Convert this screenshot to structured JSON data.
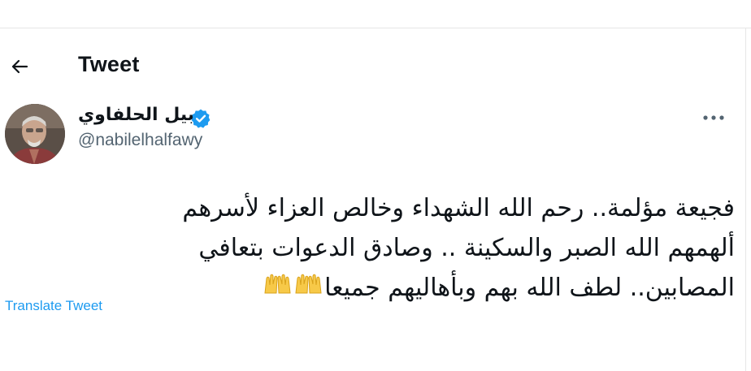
{
  "header": {
    "title": "Tweet",
    "back_icon": "arrow-left-icon"
  },
  "author": {
    "name": "نبيل الحلفاوي",
    "handle": "@nabilelhalfawy",
    "verified": true,
    "verified_color": "#1d9bf0"
  },
  "tweet": {
    "lines": [
      "فجيعة مؤلمة.. رحم الله الشهداء وخالص العزاء لأسرهم",
      "ألهمهم الله الصبر والسكينة .. وصادق الدعوات بتعافي",
      "المصابين.. لطف الله بهم وبأهاليهم جميعا"
    ],
    "emojis": [
      "🤲",
      "🤲"
    ],
    "more_icon": "more-horizontal-icon"
  },
  "translate": {
    "label": "Translate Tweet",
    "color": "#1d9bf0"
  }
}
